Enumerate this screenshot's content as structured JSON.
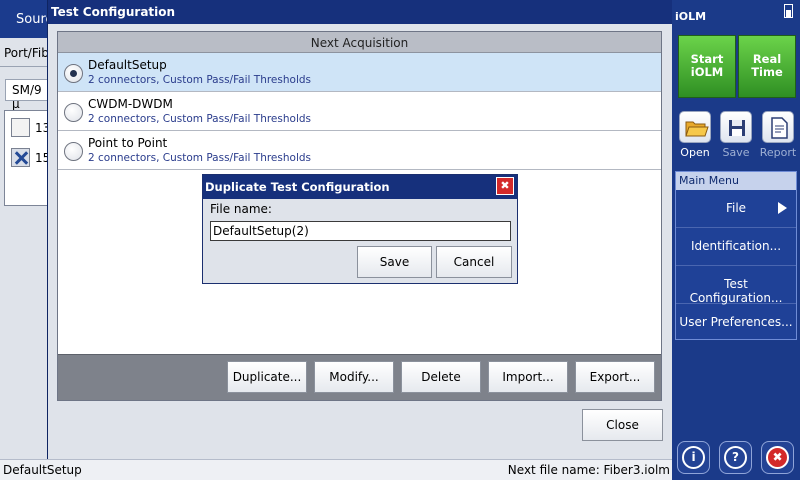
{
  "background": {
    "tab_label": "Sourc",
    "port_label": "Port/Fib",
    "fiber_value": "SM/9 µ",
    "wavelengths": [
      {
        "label": "13",
        "checked": false
      },
      {
        "label": "15",
        "checked": true
      }
    ],
    "status_left": "DefaultSetup",
    "status_right": "Next file name: Fiber3.iolm"
  },
  "dialog": {
    "title": "Test Configuration",
    "header": "Next Acquisition",
    "configs": [
      {
        "name": "DefaultSetup",
        "desc": "2 connectors, Custom Pass/Fail Thresholds",
        "selected": true
      },
      {
        "name": "CWDM-DWDM",
        "desc": "2 connectors, Custom Pass/Fail Thresholds",
        "selected": false
      },
      {
        "name": "Point to Point",
        "desc": "2 connectors, Custom Pass/Fail Thresholds",
        "selected": false
      }
    ],
    "actions": {
      "duplicate": "Duplicate...",
      "modify": "Modify...",
      "delete": "Delete",
      "import": "Import...",
      "export": "Export..."
    },
    "close_label": "Close"
  },
  "duplicate_dialog": {
    "title": "Duplicate Test Configuration",
    "close_glyph": "✖",
    "file_name_label": "File name:",
    "file_name_value": "DefaultSetup(2)",
    "save_label": "Save",
    "cancel_label": "Cancel"
  },
  "sidebar": {
    "title": "iOLM",
    "start_label": "Start\niOLM",
    "realtime_label": "Real\nTime",
    "tools": [
      {
        "label": "Open",
        "icon": "folder-open-icon",
        "enabled": true
      },
      {
        "label": "Save",
        "icon": "floppy-disk-icon",
        "enabled": false
      },
      {
        "label": "Report",
        "icon": "report-document-icon",
        "enabled": false
      }
    ],
    "menu_header": "Main Menu",
    "menu_items": [
      "File",
      "Identification...",
      "Test Configuration...",
      "User Preferences..."
    ],
    "bottom_glyphs": {
      "info": "i",
      "help": "?",
      "exit": "✖"
    }
  }
}
